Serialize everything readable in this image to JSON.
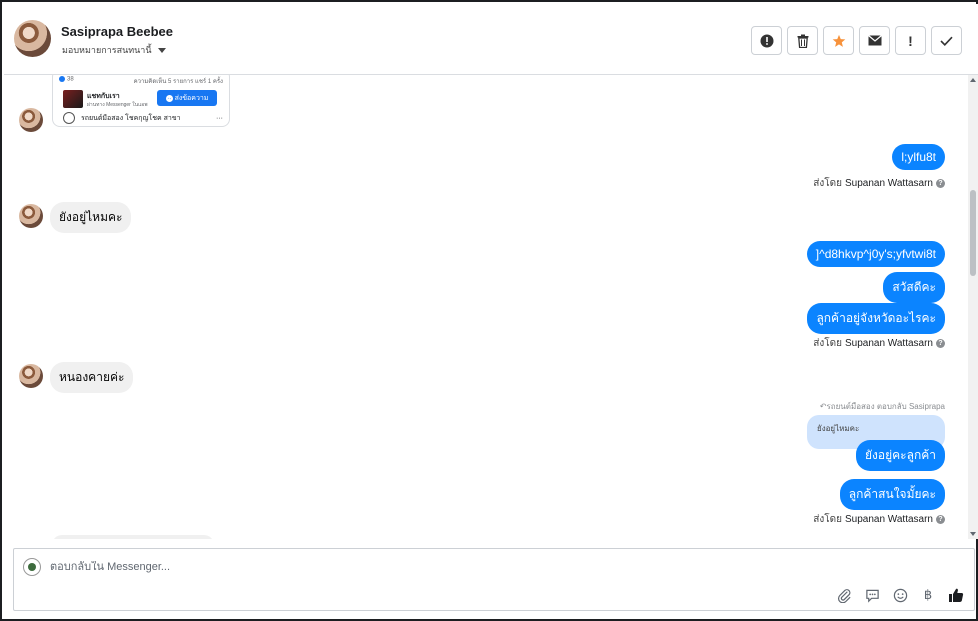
{
  "header": {
    "contact_name": "Sasiprapa Beebee",
    "assign_label": "มอบหมายการสนทนานี้",
    "toolbar": {
      "spam": "!",
      "delete": "trash",
      "star": "★",
      "mail": "✉",
      "important": "!",
      "done": "✓"
    }
  },
  "shared_card": {
    "likes": "38",
    "meta": "ความคิดเห็น 5 รายการ แชร์ 1 ครั้ง",
    "title": "แชทกับเรา",
    "subtitle": "ผ่านทาง Messenger ในแอพ",
    "button": "ส่งข้อความ",
    "page_name": "รถยนต์มือสอง โชคกุญโชค สาขา",
    "more": "···"
  },
  "messages": {
    "out1": "l;ylfu8t",
    "sent_prefix": "ส่งโดย",
    "agent": "Supanan Wattasarn",
    "in1": "ยังอยู่ไหมคะ",
    "out2": "]^d8hkvp^j0y's;yfvtwi8t",
    "out3": "สวัสดีคะ",
    "out4": "ลูกค้าอยู่จังหวัดอะไรคะ",
    "in2": "หนองคายค่ะ",
    "reply_note": "↶รถยนต์มือสอง ตอบกลับ Sasiprapa",
    "quoted": "ยังอยู่ไหมคะ",
    "out5": "ยังอยู่คะลูกค้า",
    "out6": "ลูกค้าสนใจมั้ยคะ"
  },
  "composer": {
    "placeholder": "ตอบกลับใน Messenger...",
    "baht": "฿"
  },
  "colors": {
    "outgoing": "#0b84ff",
    "incoming": "#f0f0f0",
    "quoted": "#cfe3fd",
    "star": "#f7923b"
  }
}
